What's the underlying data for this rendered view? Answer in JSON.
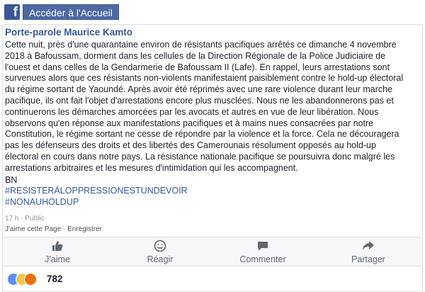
{
  "header": {
    "logo_letter": "f",
    "home_button": "Accéder à l'Accueil"
  },
  "post": {
    "author": "Porte-parole Maurice Kamto",
    "lines": [
      "Cette nuit, près d'une quarantaine environ de résistants pacifiques arrêtés ce dimanche 4 novembre",
      "2018 à Bafoussam, dorment dans les cellules de la Direction Régionale de la Police Judiciaire de",
      "l'ouest et dans celles de la Gendarmerie de Bafoussam II (Lafe). En rappel, leurs arrestations sont",
      "survenues alors que ces résistants non-violents manifestaient paisiblement contre le hold-up électoral",
      "du régime sortant de Yaoundé. Après avoir été réprimés avec une rare violence durant leur marche",
      "pacifique, ils ont fait l'objet d'arrestations encore plus musclées. Nous ne les abandonnerons pas et",
      "continuerons les démarches amorcées par les avocats et autres en vue de leur libération. Nous",
      "observons qu'en réponse aux manifestations pacifiques et à mains nues consacrées par notre",
      "Constitution, le régime sortant ne cesse de répondre par la violence et la force. Cela ne découragera",
      "pas les défenseurs des droits et des libertés des Camerounais résolument opposés au hold-up",
      "électoral en cours dans notre pays. La résistance nationale pacifique se poursuivra donc malgré les",
      "arrestations arbitraires et les mesures d'intimidation qui les accompagnent."
    ],
    "signature": "BN",
    "hashtags": [
      "#RESISTERÁLOPPRESSIONESTUNDEVOIR",
      "#NONAUHOLDUP"
    ],
    "time": "17 h · Public",
    "like_page": "J'aime cette Page",
    "separator": " · ",
    "save": "Enregistrer"
  },
  "actions": {
    "like": "J'aime",
    "react": "Réagir",
    "comment": "Commenter",
    "share": "Partager"
  },
  "reactions": {
    "count": "782",
    "icons": [
      "like-reaction-icon",
      "sad-reaction-icon",
      "angry-reaction-icon"
    ],
    "colors": {
      "like": "#5890ff",
      "sad": "#f7c548",
      "angry": "#e9710f"
    }
  },
  "colors": {
    "brand": "#3b5998",
    "link": "#365899"
  }
}
